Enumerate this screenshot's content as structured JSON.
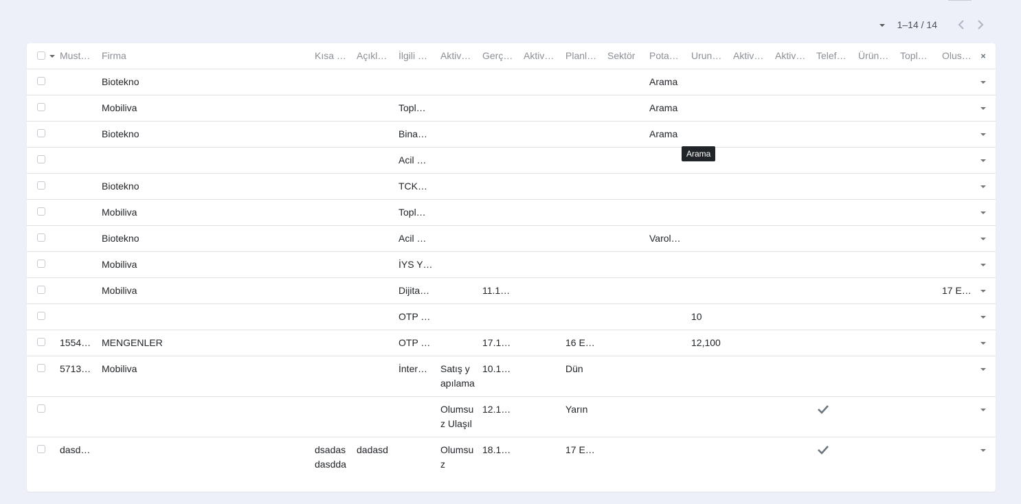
{
  "pager": {
    "range": "1–14 / 14",
    "prev_icon": "chevron-left-icon",
    "next_icon": "chevron-right-icon"
  },
  "columns": [
    "Must…",
    "Firma",
    "Kısa …",
    "Açıkl…",
    "İlgili …",
    "Aktiv…",
    "Gerç…",
    "Aktiv…",
    "Planl…",
    "Sektör",
    "Pota…",
    "Urun…",
    "Aktiv…",
    "Aktiv…",
    "Telef…",
    "Ürün…",
    "Topl…",
    "Olus…"
  ],
  "close_label": "×",
  "rows": [
    {
      "firma": "Biotekno",
      "pota": "Arama"
    },
    {
      "firma": "Mobiliva",
      "ilgili": "Topl…",
      "pota": "Arama"
    },
    {
      "firma": "Biotekno",
      "ilgili": "Bina…",
      "pota": "Arama"
    },
    {
      "ilgili": "Acil …"
    },
    {
      "firma": "Biotekno",
      "ilgili": "TCK…"
    },
    {
      "firma": "Mobiliva",
      "ilgili": "Topl…"
    },
    {
      "firma": "Biotekno",
      "ilgili": "Acil …",
      "pota": "Varol…"
    },
    {
      "firma": "Mobiliva",
      "ilgili": "İYS Y…"
    },
    {
      "firma": "Mobiliva",
      "ilgili": "Dijita…",
      "gerc": "11.1…",
      "olus": "17 E…"
    },
    {
      "ilgili": "OTP …",
      "urun": "10"
    },
    {
      "must": "1554…",
      "firma": "MENGENLER",
      "ilgili": "OTP …",
      "gerc": "17.1…",
      "planl": "16 E…",
      "urun": "12,100"
    },
    {
      "must": "5713…",
      "firma": "Mobiliva",
      "ilgili": "İnter…",
      "aktiv1": "Satış yapılamadı Bilgi Verildi",
      "gerc": "10.1…",
      "planl": "Dün"
    },
    {
      "aktiv1": "Olumsuz Ulaşılamadı",
      "gerc": "12.1…",
      "planl": "Yarın",
      "telef": true
    },
    {
      "must": "dasd…",
      "kisa": "dsadasdasdda",
      "acikl": "dadasd",
      "aktiv1": "Olumsuz",
      "gerc": "18.1…",
      "planl": "17 E…",
      "telef": true
    }
  ],
  "tooltip": "Arama",
  "colors": {
    "background": "#eef0f9",
    "border": "#dee2e6",
    "header_text": "#8a8f96"
  }
}
